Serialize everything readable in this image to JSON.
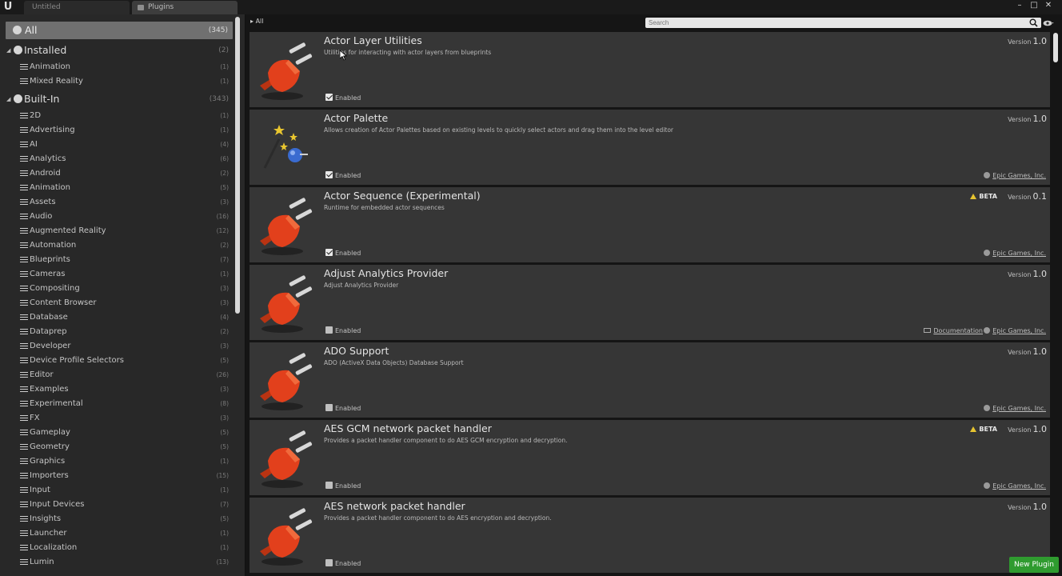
{
  "tabs": {
    "untitled": "Untitled",
    "plugins": "Plugins"
  },
  "window": {
    "minimize": "–",
    "maximize": "□",
    "close": "✕"
  },
  "breadcrumb": "All",
  "search": {
    "placeholder": "Search"
  },
  "sidebar": {
    "all": {
      "label": "All",
      "count": "(345)"
    },
    "installed": {
      "label": "Installed",
      "count": "(2)",
      "items": [
        {
          "label": "Animation",
          "count": "(1)"
        },
        {
          "label": "Mixed Reality",
          "count": "(1)"
        }
      ]
    },
    "builtin": {
      "label": "Built-In",
      "count": "(343)",
      "items": [
        {
          "label": "2D",
          "count": "(1)"
        },
        {
          "label": "Advertising",
          "count": "(1)"
        },
        {
          "label": "AI",
          "count": "(4)"
        },
        {
          "label": "Analytics",
          "count": "(6)"
        },
        {
          "label": "Android",
          "count": "(2)"
        },
        {
          "label": "Animation",
          "count": "(5)"
        },
        {
          "label": "Assets",
          "count": "(3)"
        },
        {
          "label": "Audio",
          "count": "(16)"
        },
        {
          "label": "Augmented Reality",
          "count": "(12)"
        },
        {
          "label": "Automation",
          "count": "(2)"
        },
        {
          "label": "Blueprints",
          "count": "(7)"
        },
        {
          "label": "Cameras",
          "count": "(1)"
        },
        {
          "label": "Compositing",
          "count": "(3)"
        },
        {
          "label": "Content Browser",
          "count": "(3)"
        },
        {
          "label": "Database",
          "count": "(4)"
        },
        {
          "label": "Dataprep",
          "count": "(2)"
        },
        {
          "label": "Developer",
          "count": "(3)"
        },
        {
          "label": "Device Profile Selectors",
          "count": "(5)"
        },
        {
          "label": "Editor",
          "count": "(26)"
        },
        {
          "label": "Examples",
          "count": "(3)"
        },
        {
          "label": "Experimental",
          "count": "(8)"
        },
        {
          "label": "FX",
          "count": "(3)"
        },
        {
          "label": "Gameplay",
          "count": "(5)"
        },
        {
          "label": "Geometry",
          "count": "(5)"
        },
        {
          "label": "Graphics",
          "count": "(1)"
        },
        {
          "label": "Importers",
          "count": "(15)"
        },
        {
          "label": "Input",
          "count": "(1)"
        },
        {
          "label": "Input Devices",
          "count": "(7)"
        },
        {
          "label": "Insights",
          "count": "(5)"
        },
        {
          "label": "Launcher",
          "count": "(1)"
        },
        {
          "label": "Localization",
          "count": "(1)"
        },
        {
          "label": "Lumin",
          "count": "(13)"
        }
      ]
    }
  },
  "plugins": [
    {
      "name": "Actor Layer Utilities",
      "description": "Utilities for interacting with actor layers from blueprints",
      "version_label": "Version",
      "version": "1.0",
      "enabled_label": "Enabled",
      "enabled": true,
      "beta": "",
      "docs": "",
      "vendor": "",
      "icon": "plug-icon"
    },
    {
      "name": "Actor Palette",
      "description": "Allows creation of Actor Palettes based on existing levels to quickly select actors and drag them into the level editor",
      "version_label": "Version",
      "version": "1.0",
      "enabled_label": "Enabled",
      "enabled": true,
      "beta": "",
      "docs": "",
      "vendor": "Epic Games, Inc.",
      "icon": "magic-wand-icon"
    },
    {
      "name": "Actor Sequence (Experimental)",
      "description": "Runtime for embedded actor sequences",
      "version_label": "Version",
      "version": "0.1",
      "enabled_label": "Enabled",
      "enabled": true,
      "beta": "BETA",
      "docs": "",
      "vendor": "Epic Games, Inc.",
      "icon": "plug-icon"
    },
    {
      "name": "Adjust Analytics Provider",
      "description": "Adjust Analytics Provider",
      "version_label": "Version",
      "version": "1.0",
      "enabled_label": "Enabled",
      "enabled": false,
      "beta": "",
      "docs": "Documentation",
      "vendor": "Epic Games, Inc.",
      "icon": "plug-icon"
    },
    {
      "name": "ADO Support",
      "description": "ADO (ActiveX Data Objects) Database Support",
      "version_label": "Version",
      "version": "1.0",
      "enabled_label": "Enabled",
      "enabled": false,
      "beta": "",
      "docs": "",
      "vendor": "Epic Games, Inc.",
      "icon": "plug-icon"
    },
    {
      "name": "AES GCM network packet handler",
      "description": "Provides a packet handler component to do AES GCM encryption and decryption.",
      "version_label": "Version",
      "version": "1.0",
      "enabled_label": "Enabled",
      "enabled": false,
      "beta": "BETA",
      "docs": "",
      "vendor": "Epic Games, Inc.",
      "icon": "plug-icon"
    },
    {
      "name": "AES network packet handler",
      "description": "Provides a packet handler component to do AES encryption and decryption.",
      "version_label": "Version",
      "version": "1.0",
      "enabled_label": "Enabled",
      "enabled": false,
      "beta": "",
      "docs": "",
      "vendor": "",
      "icon": "plug-icon"
    }
  ],
  "new_plugin_label": "New Plugin",
  "colors": {
    "accent_green": "#2f9b2f",
    "plug_red": "#e2401c",
    "beta_yellow": "#e6c430"
  }
}
